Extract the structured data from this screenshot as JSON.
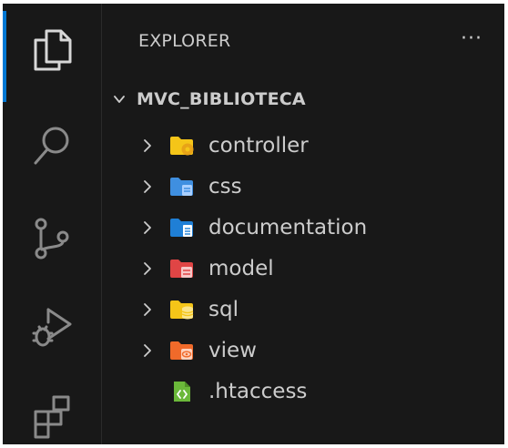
{
  "sidebar": {
    "title": "EXPLORER",
    "more_actions_label": "···",
    "root_folder": "MVC_BIBLIOTECA",
    "items": [
      {
        "label": "controller",
        "kind": "folder",
        "icon": "folder-controller-icon",
        "color": "#f5c518",
        "badge_color": "#e8a317"
      },
      {
        "label": "css",
        "kind": "folder",
        "icon": "folder-css-icon",
        "color": "#3f8fe0",
        "badge_color": "#a9cfff"
      },
      {
        "label": "documentation",
        "kind": "folder",
        "icon": "folder-docs-icon",
        "color": "#1f7fd6",
        "badge_color": "#ffffff"
      },
      {
        "label": "model",
        "kind": "folder",
        "icon": "folder-model-icon",
        "color": "#e04545",
        "badge_color": "#f7c7c7"
      },
      {
        "label": "sql",
        "kind": "folder",
        "icon": "folder-database-icon",
        "color": "#f5c518",
        "badge_color": "#fbe48a"
      },
      {
        "label": "view",
        "kind": "folder",
        "icon": "folder-view-icon",
        "color": "#f06a2a",
        "badge_color": "#ffd2bd"
      },
      {
        "label": ".htaccess",
        "kind": "file",
        "icon": "htaccess-file-icon",
        "color": "#6bb83a",
        "badge_color": "#ffffff"
      }
    ]
  },
  "activity_bar": {
    "items": [
      {
        "name": "explorer-icon",
        "active": true
      },
      {
        "name": "search-icon",
        "active": false
      },
      {
        "name": "source-control-icon",
        "active": false
      },
      {
        "name": "run-debug-icon",
        "active": false
      },
      {
        "name": "extensions-icon",
        "active": false
      }
    ]
  },
  "theme": {
    "background": "#181818",
    "text": "#cccccc",
    "accent": "#0078d4"
  }
}
